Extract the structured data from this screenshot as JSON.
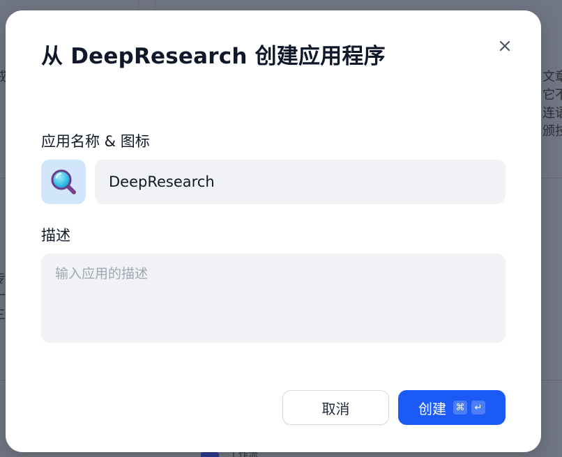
{
  "background": {
    "fragments_right": [
      "文章",
      "它不",
      "连语",
      "颁技"
    ],
    "fragments_left": [
      "戒",
      "专",
      "一",
      "三"
    ],
    "fragment_bottom": "工作流"
  },
  "dialog": {
    "title": "从 DeepResearch 创建应用程序",
    "close_icon": "close-icon",
    "name_section": {
      "label": "应用名称 & 图标",
      "icon": "magnifying-glass-icon",
      "name_value": "DeepResearch"
    },
    "description_section": {
      "label": "描述",
      "placeholder": "输入应用的描述",
      "value": ""
    },
    "actions": {
      "cancel_label": "取消",
      "create_label": "创建",
      "shortcut_cmd": "⌘",
      "shortcut_enter": "↵"
    }
  },
  "colors": {
    "overlay": "#717684",
    "primary": "#1c5af5",
    "input_bg": "#f1f2f6",
    "icon_bg": "#d1e6fb"
  }
}
